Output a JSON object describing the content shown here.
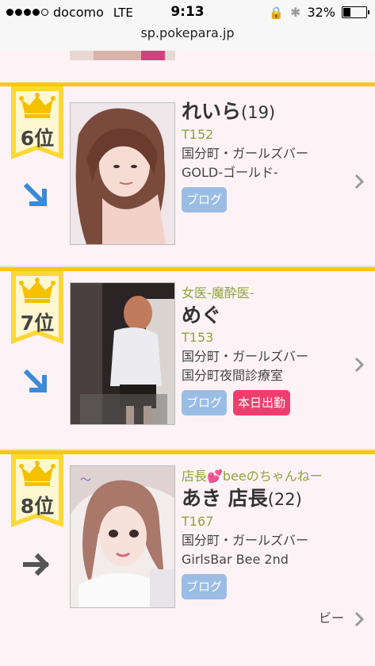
{
  "status_bar": {
    "carrier": "docomo",
    "network": "LTE",
    "time": "9:13",
    "battery": "32%",
    "battery_level": 0.32
  },
  "url_bar": {
    "url": "sp.pokepara.jp"
  },
  "ranking": [
    {
      "rank": "6位",
      "trend": "down",
      "catchphrase": "",
      "name": "れいら",
      "age": "(19)",
      "height": "T152",
      "area": "国分町・ガールズバー",
      "shop": "GOLD-ゴールド-",
      "tags": [
        "ブログ"
      ]
    },
    {
      "rank": "7位",
      "trend": "down",
      "catchphrase": "女医-魔酔医-",
      "name": "めぐ",
      "age": "",
      "height": "T153",
      "area": "国分町・ガールズバー",
      "shop": "国分町夜間診療室",
      "tags": [
        "ブログ",
        "本日出勤"
      ]
    },
    {
      "rank": "8位",
      "trend": "flat",
      "catchphrase": "店長💕beeのちゃんねー",
      "name": "あき 店長",
      "age": "(22)",
      "height": "T167",
      "area": "国分町・ガールズバー",
      "shop": "GirlsBar Bee 2nd",
      "shop_suffix": "ビー",
      "tags": [
        "ブログ"
      ]
    }
  ],
  "colors": {
    "card_bg": "#fdf3f6",
    "accent_gold": "#f6c90e",
    "green_text": "#8da53b",
    "blog_tag": "#9bbde4",
    "working_tag": "#ef3e6d",
    "trend_blue": "#3b8ad6"
  },
  "icons": [
    "crown-icon",
    "arrow-down-right-icon",
    "arrow-right-icon",
    "chevron-right-icon"
  ]
}
